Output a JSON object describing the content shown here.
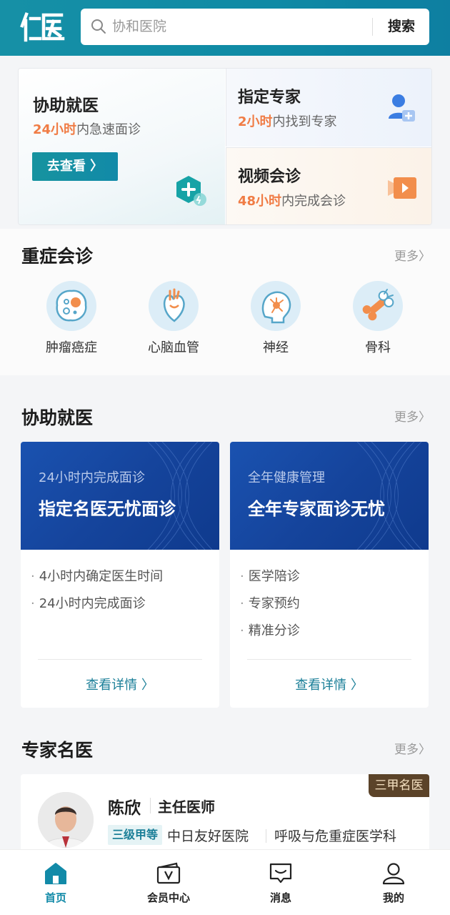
{
  "header": {
    "logo_text": "仁医",
    "search_placeholder": "协和医院",
    "search_button": "搜索"
  },
  "top_cards": {
    "assist": {
      "title": "协助就医",
      "highlight": "24小时",
      "subtitle_rest": "内急速面诊",
      "button": "去查看 〉"
    },
    "expert": {
      "title": "指定专家",
      "highlight": "2小时",
      "subtitle_rest": "内找到专家"
    },
    "video": {
      "title": "视频会诊",
      "highlight": "48小时",
      "subtitle_rest": "内完成会诊"
    }
  },
  "critical": {
    "title": "重症会诊",
    "more": "更多〉",
    "categories": [
      {
        "label": "肿瘤癌症",
        "icon": "tumor-cell-icon"
      },
      {
        "label": "心脑血管",
        "icon": "heart-icon"
      },
      {
        "label": "神经",
        "icon": "brain-neuron-icon"
      },
      {
        "label": "骨科",
        "icon": "bone-icon"
      }
    ]
  },
  "assist_section": {
    "title": "协助就医",
    "more": "更多〉",
    "cards": [
      {
        "subtitle": "24小时内完成面诊",
        "headline": "指定名医无忧面诊",
        "bullets": [
          "4小时内确定医生时间",
          "24小时内完成面诊"
        ],
        "detail": "查看详情 〉"
      },
      {
        "subtitle": "全年健康管理",
        "headline": "全年专家面诊无忧",
        "bullets": [
          "医学陪诊",
          "专家预约",
          "精准分诊"
        ],
        "detail": "查看详情 〉"
      }
    ]
  },
  "experts": {
    "title": "专家名医",
    "more": "更多〉",
    "doctor": {
      "tag": "三甲名医",
      "name": "陈欣",
      "title": "主任医师",
      "grade": "三级甲等",
      "hospital": "中日友好医院",
      "department": "呼吸与危重症医学科"
    }
  },
  "nav": {
    "items": [
      {
        "label": "首页",
        "icon": "home-icon",
        "active": true
      },
      {
        "label": "会员中心",
        "icon": "member-card-icon",
        "active": false
      },
      {
        "label": "消息",
        "icon": "message-icon",
        "active": false
      },
      {
        "label": "我的",
        "icon": "profile-icon",
        "active": false
      }
    ]
  },
  "colors": {
    "brand": "#128aa8",
    "highlight": "#f07c45",
    "banner": "#15449c"
  }
}
